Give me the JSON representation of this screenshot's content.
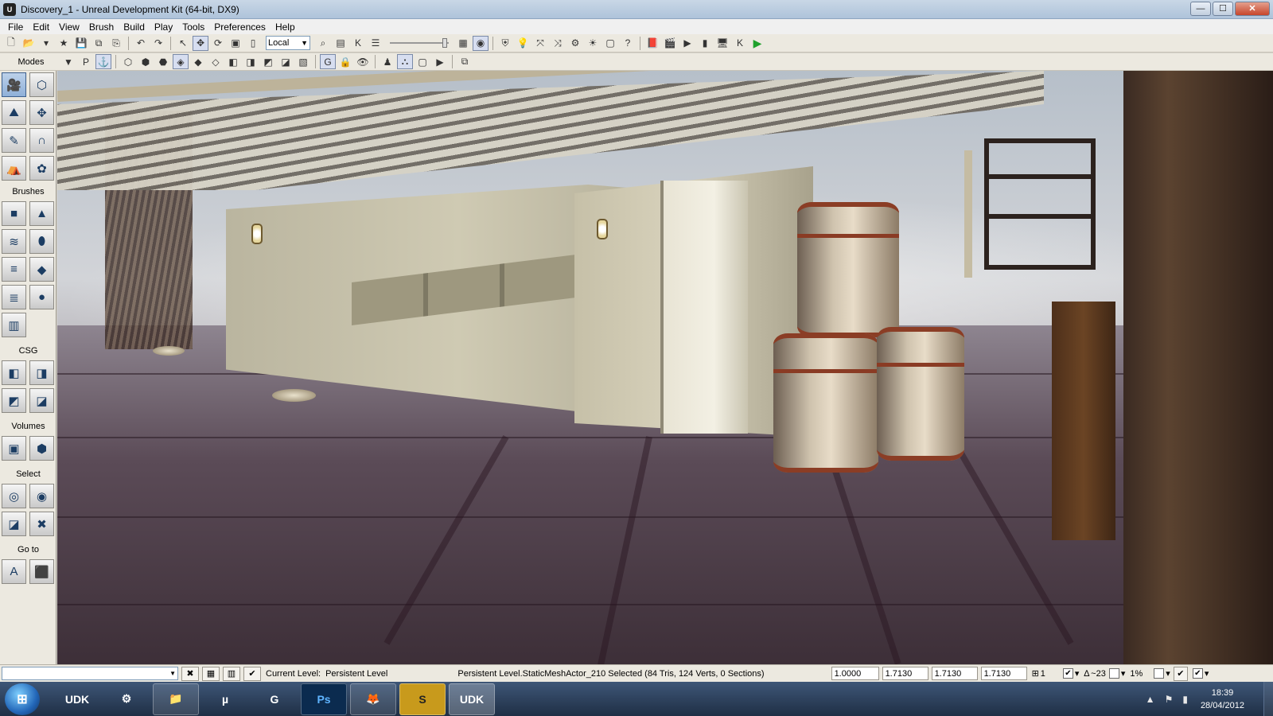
{
  "window": {
    "title": "Discovery_1 - Unreal Development Kit (64-bit, DX9)",
    "app_icon": "U",
    "min": "—",
    "max": "☐",
    "close": "✕"
  },
  "menu": {
    "items": [
      "File",
      "Edit",
      "View",
      "Brush",
      "Build",
      "Play",
      "Tools",
      "Preferences",
      "Help"
    ]
  },
  "toolbar": {
    "coordinate_system": "Local",
    "dropdown_arrow": "▼"
  },
  "toolbar2": {
    "modes_label": "Modes",
    "perspective_label": "P",
    "grid_label": "G"
  },
  "mode_panel": {
    "sections": {
      "brushes": "Brushes",
      "csg": "CSG",
      "volumes": "Volumes",
      "select": "Select",
      "goto": "Go to"
    },
    "goto_actor_label": "A"
  },
  "statusbar": {
    "cmd_dropdown": "▼",
    "current_level_label": "Current Level:",
    "current_level_value": "Persistent Level",
    "selection_info": "Persistent Level.StaticMeshActor_210 Selected (84 Tris, 124 Verts, 0 Sections)",
    "drag_grid": "1.0000",
    "scale_x": "1.7130",
    "scale_y": "1.7130",
    "scale_z": "1.7130",
    "grid_size": "1",
    "rotation_snap": "~23",
    "scale_snap": "1%"
  },
  "taskbar": {
    "start_label": "⊞",
    "items": [
      {
        "label": "UDK",
        "name": "taskbar-udk-pinned",
        "open": false
      },
      {
        "label": "⚙",
        "name": "taskbar-steam",
        "open": false
      },
      {
        "label": "📁",
        "name": "taskbar-explorer",
        "open": true
      },
      {
        "label": "µ",
        "name": "taskbar-utorrent",
        "open": false
      },
      {
        "label": "G",
        "name": "taskbar-app-g",
        "open": false
      },
      {
        "label": "Ps",
        "name": "taskbar-photoshop",
        "open": true
      },
      {
        "label": "🦊",
        "name": "taskbar-firefox",
        "open": true
      },
      {
        "label": "S",
        "name": "taskbar-app-s",
        "open": true
      },
      {
        "label": "UDK",
        "name": "taskbar-udk-active",
        "open": true
      }
    ],
    "tray_arrow": "▲",
    "tray_flag": "⚑",
    "tray_signal": "▮",
    "time": "18:39",
    "date": "28/04/2012"
  },
  "colors": {
    "accent": "#3c5f8c",
    "play_green": "#1fa12c"
  }
}
